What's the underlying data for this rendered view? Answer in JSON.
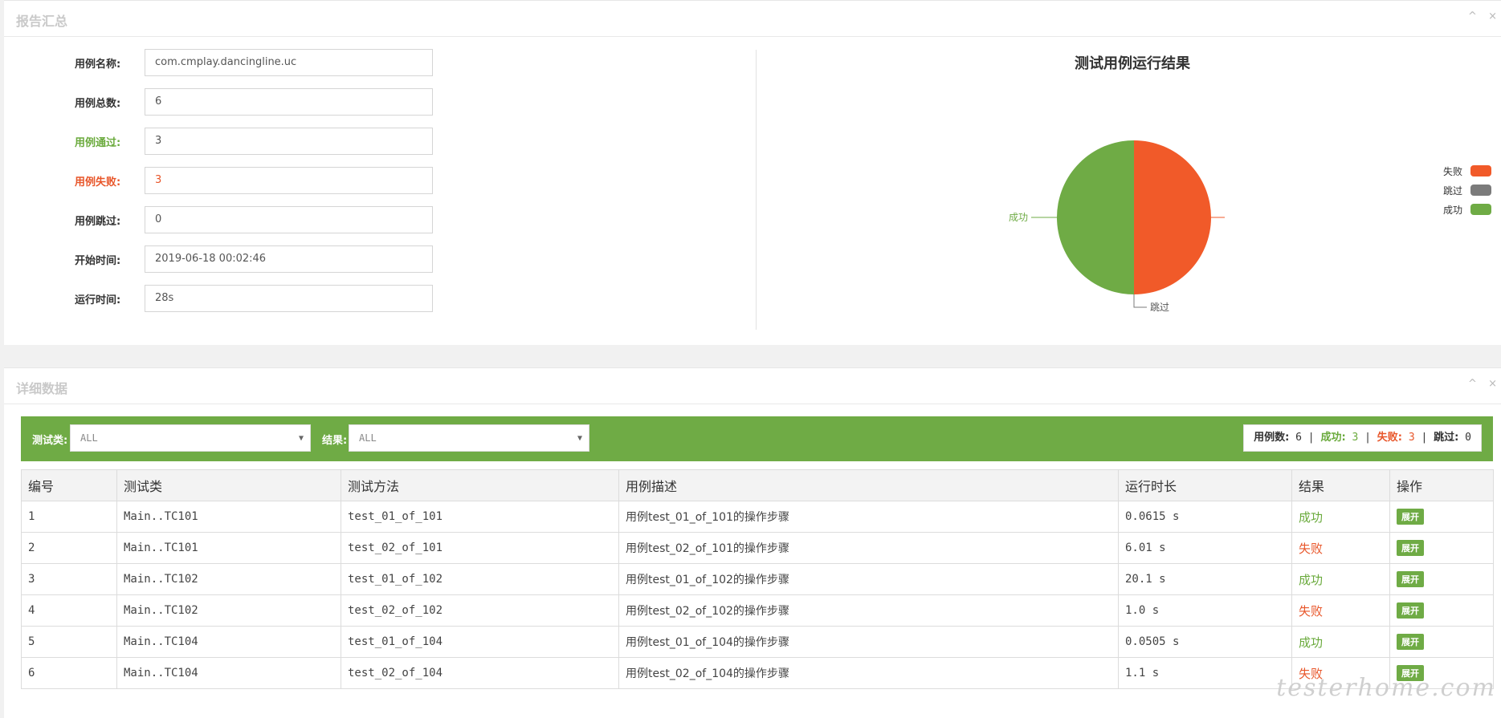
{
  "summary": {
    "title": "报告汇总",
    "tools": {
      "collapse": "^",
      "close": "×"
    },
    "fields": [
      {
        "label": "用例名称:",
        "value": "com.cmplay.dancingline.uc"
      },
      {
        "label": "用例总数:",
        "value": "6"
      },
      {
        "label": "用例通过:",
        "value": "3"
      },
      {
        "label": "用例失败:",
        "value": "3"
      },
      {
        "label": "用例跳过:",
        "value": "0"
      },
      {
        "label": "开始时间:",
        "value": "2019-06-18 00:02:46"
      },
      {
        "label": "运行时间:",
        "value": "28s"
      }
    ]
  },
  "chart_data": {
    "type": "pie",
    "title": "测试用例运行结果",
    "slices": [
      {
        "name": "失败",
        "value": 3,
        "color": "#f15a29"
      },
      {
        "name": "跳过",
        "value": 0,
        "color": "#7b7b7b"
      },
      {
        "name": "成功",
        "value": 3,
        "color": "#6fab45"
      }
    ],
    "legend": [
      "失败",
      "跳过",
      "成功"
    ],
    "legend_position": "right"
  },
  "detail": {
    "title": "详细数据",
    "tools": {
      "collapse": "^",
      "close": "×"
    },
    "filter": {
      "class_label": "测试类:",
      "class_value": "ALL",
      "result_label": "结果:",
      "result_value": "ALL",
      "caret": "▼"
    },
    "stats": {
      "total_label": "用例数:",
      "total": "6",
      "pass_label": "成功:",
      "pass": "3",
      "fail_label": "失败:",
      "fail": "3",
      "skip_label": "跳过:",
      "skip": "0",
      "sep": "|"
    },
    "columns": [
      "编号",
      "测试类",
      "测试方法",
      "用例描述",
      "运行时长",
      "结果",
      "操作"
    ],
    "rows": [
      {
        "id": "1",
        "cls": "Main..TC101",
        "method": "test_01_of_101",
        "desc": "用例test_01_of_101的操作步骤",
        "duration": "0.0615 s",
        "result": "成功",
        "action": "展开"
      },
      {
        "id": "2",
        "cls": "Main..TC101",
        "method": "test_02_of_101",
        "desc": "用例test_02_of_101的操作步骤",
        "duration": "6.01 s",
        "result": "失败",
        "action": "展开"
      },
      {
        "id": "3",
        "cls": "Main..TC102",
        "method": "test_01_of_102",
        "desc": "用例test_01_of_102的操作步骤",
        "duration": "20.1 s",
        "result": "成功",
        "action": "展开"
      },
      {
        "id": "4",
        "cls": "Main..TC102",
        "method": "test_02_of_102",
        "desc": "用例test_02_of_102的操作步骤",
        "duration": "1.0 s",
        "result": "失败",
        "action": "展开"
      },
      {
        "id": "5",
        "cls": "Main..TC104",
        "method": "test_01_of_104",
        "desc": "用例test_01_of_104的操作步骤",
        "duration": "0.0505 s",
        "result": "成功",
        "action": "展开"
      },
      {
        "id": "6",
        "cls": "Main..TC104",
        "method": "test_02_of_104",
        "desc": "用例test_02_of_104的操作步骤",
        "duration": "1.1 s",
        "result": "失败",
        "action": "展开"
      }
    ]
  },
  "watermark": "testerhome.com"
}
